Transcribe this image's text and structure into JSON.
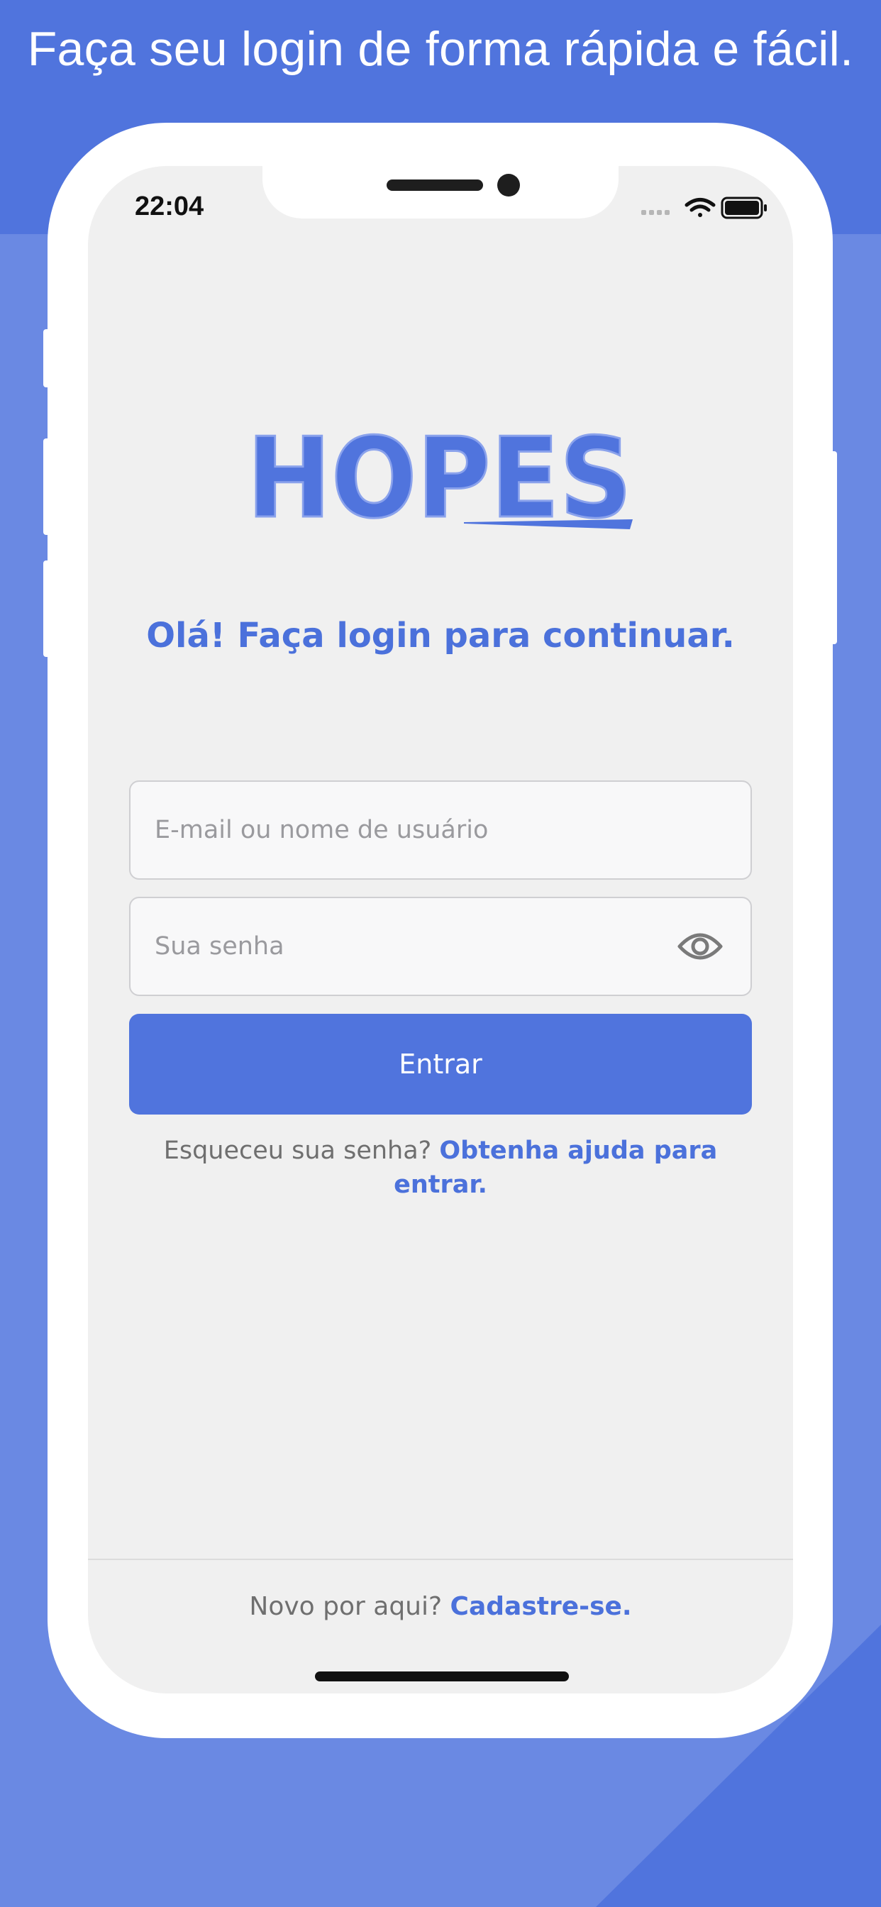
{
  "promo": {
    "headline": "Faça seu login de forma rápida e fácil."
  },
  "status_bar": {
    "time": "22:04",
    "icons": [
      "signal-icon",
      "wifi-icon",
      "battery-icon"
    ]
  },
  "app": {
    "logo_text": "HOPES",
    "greeting": "Olá! Faça login para continuar.",
    "email_placeholder": "E-mail ou nome de usuário",
    "password_placeholder": "Sua senha",
    "login_button": "Entrar",
    "forgot_prefix": "Esqueceu sua senha?",
    "forgot_link": "Obtenha ajuda para entrar.",
    "signup_prefix": "Novo por aqui?",
    "signup_link": "Cadastre-se."
  },
  "colors": {
    "background": "#5074dd",
    "accent": "#4b71db",
    "button": "#5074dd",
    "screen": "#f0f0f0"
  }
}
